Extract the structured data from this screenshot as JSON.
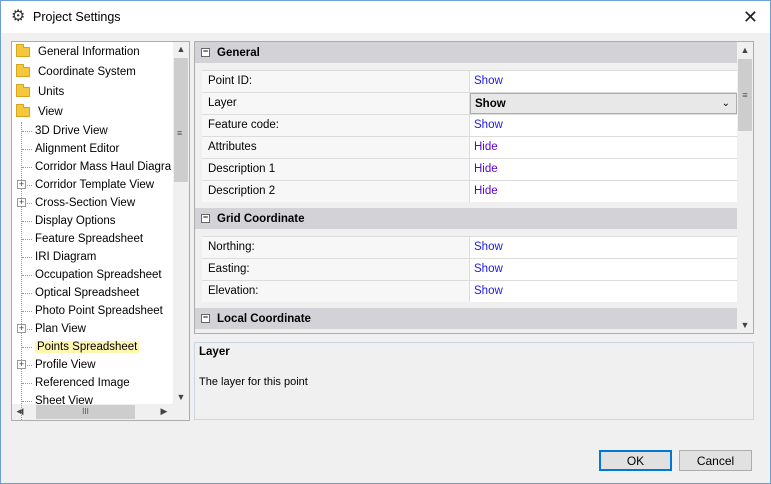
{
  "window": {
    "title": "Project Settings",
    "icon": "gear-icon",
    "close": "✕"
  },
  "tree": {
    "top_items": [
      "General Information",
      "Coordinate System",
      "Units",
      "View"
    ],
    "children": [
      {
        "label": "3D Drive View",
        "expandable": false
      },
      {
        "label": "Alignment Editor",
        "expandable": false
      },
      {
        "label": "Corridor Mass Haul Diagra",
        "expandable": false
      },
      {
        "label": "Corridor Template View",
        "expandable": true
      },
      {
        "label": "Cross-Section View",
        "expandable": true
      },
      {
        "label": "Display Options",
        "expandable": false
      },
      {
        "label": "Feature Spreadsheet",
        "expandable": false
      },
      {
        "label": "IRI Diagram",
        "expandable": false
      },
      {
        "label": "Occupation Spreadsheet",
        "expandable": false
      },
      {
        "label": "Optical Spreadsheet",
        "expandable": false
      },
      {
        "label": "Photo Point Spreadsheet",
        "expandable": false
      },
      {
        "label": "Plan View",
        "expandable": true
      },
      {
        "label": "Points Spreadsheet",
        "expandable": false,
        "selected": true
      },
      {
        "label": "Profile View",
        "expandable": true
      },
      {
        "label": "Referenced Image",
        "expandable": false
      },
      {
        "label": "Sheet View",
        "expandable": false
      }
    ],
    "selection_color": "#fff7b0"
  },
  "grid": {
    "categories": [
      {
        "name": "General",
        "rows": [
          {
            "label": "Point ID:",
            "value": "Show"
          },
          {
            "label": "Layer",
            "value": "Show",
            "combo": true
          },
          {
            "label": "Feature code:",
            "value": "Show"
          },
          {
            "label": "Attributes",
            "value": "Hide"
          },
          {
            "label": "Description 1",
            "value": "Hide"
          },
          {
            "label": "Description 2",
            "value": "Hide"
          }
        ]
      },
      {
        "name": "Grid Coordinate",
        "rows": [
          {
            "label": "Northing:",
            "value": "Show"
          },
          {
            "label": "Easting:",
            "value": "Show"
          },
          {
            "label": "Elevation:",
            "value": "Show"
          }
        ]
      },
      {
        "name": "Local Coordinate",
        "rows": []
      }
    ]
  },
  "description": {
    "title": "Layer",
    "text": "The layer for this point"
  },
  "buttons": {
    "ok": "OK",
    "cancel": "Cancel"
  }
}
